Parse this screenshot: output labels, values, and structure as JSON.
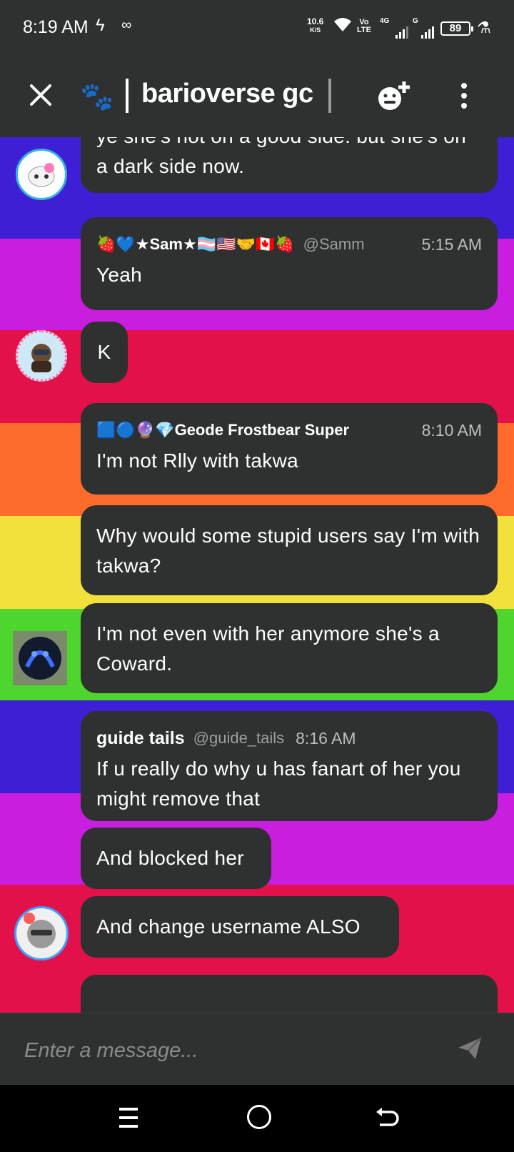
{
  "status_bar": {
    "time": "8:19 AM",
    "icons": [
      "bolt-icon",
      "infinity-icon"
    ],
    "net_speed_value": "10.6",
    "net_speed_unit": "K/S",
    "volte_top": "Vo",
    "volte_bottom": "LTE",
    "sim1_label": "4G",
    "sim2_label": "G",
    "battery": "89"
  },
  "header": {
    "title": "barioverse gc",
    "icons": [
      "close-icon",
      "paw-icon",
      "add-member-icon",
      "more-vert-icon"
    ]
  },
  "background": {
    "stripes": [
      "#3f1fd6",
      "#c91de0",
      "#e3114a",
      "#ff6b2a",
      "#f2e13a",
      "#4fd62e",
      "#3f1fd6",
      "#c91de0",
      "#e3114a"
    ]
  },
  "messages": [
    {
      "text": "ye she's not on a good side. but she's on a dark side now."
    },
    {
      "author": "🍓💙★Sam★🏳️‍⚧️🇺🇸🤝🇨🇦🍓",
      "handle": "@Samm",
      "time": "5:15 AM",
      "text": "Yeah"
    },
    {
      "text": "K"
    },
    {
      "author": "🟦🔵🔮💎Geode Frostbear Super",
      "time": "8:10 AM",
      "text": "I'm not Rlly with takwa"
    },
    {
      "text": "Why would some stupid users say I'm with takwa?"
    },
    {
      "text": "I'm not even with her anymore she's a Coward."
    },
    {
      "author": "guide tails",
      "handle": "@guide_tails",
      "time": "8:16 AM",
      "text": "If u really do why u has fanart of her you might remove that"
    },
    {
      "text": "And blocked her"
    },
    {
      "text": "And change username ALSO"
    }
  ],
  "composer": {
    "placeholder": "Enter a message..."
  },
  "nav": {
    "icons": [
      "menu-icon",
      "home-icon",
      "back-icon"
    ]
  }
}
